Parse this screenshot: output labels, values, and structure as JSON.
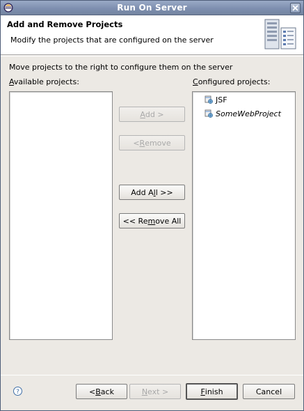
{
  "window": {
    "title": "Run On Server"
  },
  "banner": {
    "heading": "Add and Remove Projects",
    "description": "Modify the projects that are configured on the server"
  },
  "instruction": "Move projects to the right to configure them on the server",
  "available": {
    "label_mnemonic": "A",
    "label_rest": "vailable projects:",
    "items": []
  },
  "configured": {
    "label_mnemonic": "C",
    "label_rest": "onfigured projects:",
    "items": [
      {
        "label": "JSF",
        "icon": "web-project-icon",
        "italic": false
      },
      {
        "label": "SomeWebProject",
        "icon": "web-project-icon",
        "italic": true
      }
    ]
  },
  "buttons": {
    "add": {
      "pre": "",
      "mn": "A",
      "post": "dd >",
      "enabled": false
    },
    "remove": {
      "pre": "< ",
      "mn": "R",
      "post": "emove",
      "enabled": false
    },
    "add_all": {
      "pre": "Add A",
      "mn": "l",
      "post": "l >>",
      "enabled": true
    },
    "remove_all": {
      "pre": "<< Re",
      "mn": "m",
      "post": "ove All",
      "enabled": true
    },
    "back": {
      "pre": "< ",
      "mn": "B",
      "post": "ack",
      "enabled": true
    },
    "next": {
      "pre": "",
      "mn": "N",
      "post": "ext >",
      "enabled": false
    },
    "finish": {
      "pre": "",
      "mn": "F",
      "post": "inish",
      "enabled": true
    },
    "cancel": {
      "label": "Cancel",
      "enabled": true
    }
  },
  "icons": {
    "app": "eclipse-icon",
    "close": "close-icon",
    "help": "help-icon",
    "banner": "server-wizard-icon"
  }
}
